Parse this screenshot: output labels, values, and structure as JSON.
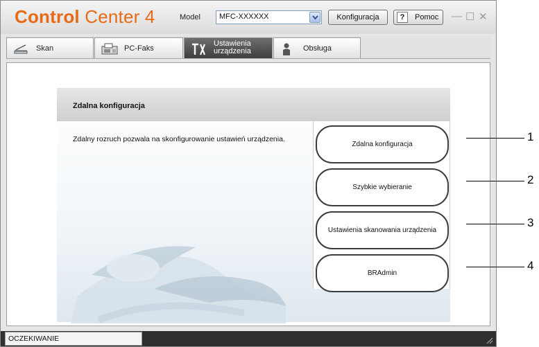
{
  "app": {
    "brand_strong": "Control",
    "brand_light": " Center 4",
    "model_label": "Model",
    "model_value": "MFC-XXXXXX",
    "config_button": "Konfiguracja",
    "help_mark": "?",
    "help_button": "Pomoc",
    "min_glyph": "—",
    "max_glyph": "☐",
    "close_glyph": "✕",
    "brand_color": "#e86a16"
  },
  "tabs": [
    {
      "label": "Skan",
      "icon": "scanner-icon",
      "active": false
    },
    {
      "label": "PC-Faks",
      "icon": "fax-icon",
      "active": false
    },
    {
      "label_line1": "Ustawienia",
      "label_line2": "urządzenia",
      "icon": "tools-icon",
      "active": true
    },
    {
      "label": "Obsługa",
      "icon": "person-icon",
      "active": false
    }
  ],
  "panel": {
    "title": "Zdalna konfiguracja",
    "description": "Zdalny rozruch pozwala na skonfigurowanie ustawień urządzenia.",
    "buttons": [
      "Zdalna konfiguracja",
      "Szybkie wybieranie",
      "Ustawienia skanowania urządzenia",
      "BRAdmin"
    ]
  },
  "status": {
    "text": "OCZEKIWANIE"
  },
  "callouts": [
    "1",
    "2",
    "3",
    "4"
  ]
}
